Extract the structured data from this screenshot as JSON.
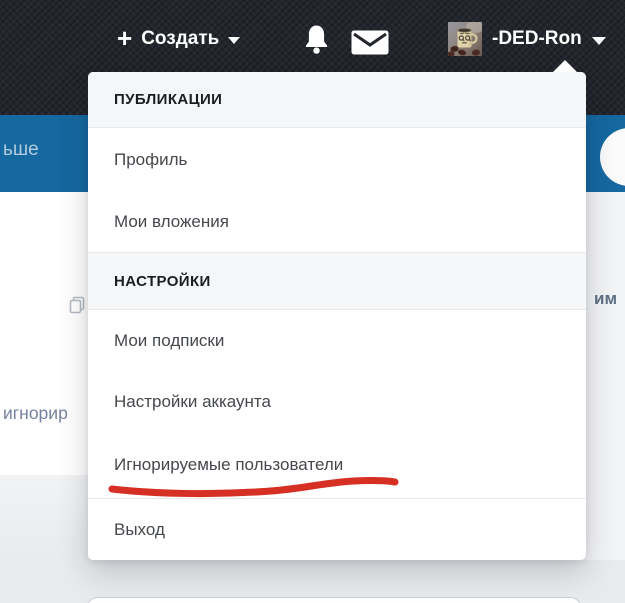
{
  "topbar": {
    "create_label": "Создать",
    "username": "-DED-Ron"
  },
  "navbar": {
    "clipped_link_text": "ьше"
  },
  "user_menu": {
    "sections": [
      {
        "header": "ПУБЛИКАЦИИ",
        "items": [
          "Профиль",
          "Мои вложения"
        ]
      },
      {
        "header": "НАСТРОЙКИ",
        "items": [
          "Мои подписки",
          "Настройки аккаунта",
          "Игнорируемые пользователи"
        ]
      }
    ],
    "logout_label": "Выход",
    "highlighted_item": "Игнорируемые пользователи"
  },
  "background_fragments": {
    "left_text": "игнорир",
    "right_text": "им"
  },
  "colors": {
    "topbar_dark": "#23262d",
    "navbar_blue": "#1568a0",
    "menu_header_bg": "#f5f6f7",
    "menu_item_text": "#45484c",
    "annotation_red": "#d62f23",
    "page_bg": "#edeff1"
  }
}
